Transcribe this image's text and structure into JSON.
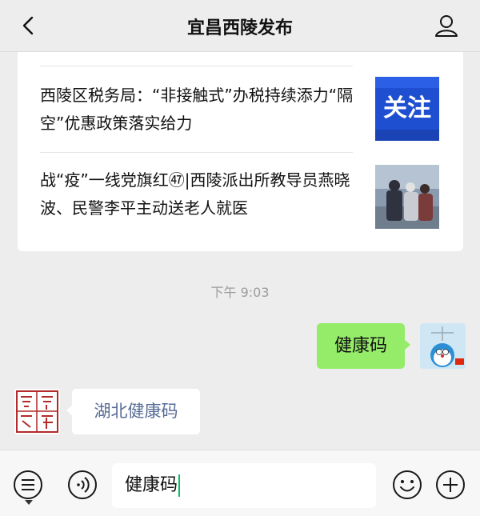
{
  "header": {
    "title": "宜昌西陵发布",
    "back_icon": "chevron-left-icon",
    "profile_icon": "person-icon"
  },
  "articles": [
    {
      "title": "西陵区税务局：“非接触式”办税持续添力“隔空”优惠政策落实给力",
      "thumb_label": "关注"
    },
    {
      "title": "战“疫”一线党旗红㊼|西陵派出所教导员燕晓波、民警李平主动送老人就医"
    }
  ],
  "chat": {
    "timestamp": "下午 9:03",
    "outgoing_message": "健康码",
    "incoming_message": "湖北健康码",
    "official_avatar_text": "西陵"
  },
  "input": {
    "value": "健康码",
    "left_icons": [
      "menu-list-icon",
      "voice-icon"
    ],
    "right_icons": [
      "emoji-icon",
      "plus-icon"
    ]
  },
  "colors": {
    "background": "#ededed",
    "outgoing_bubble": "#95ec69",
    "link_text": "#576b95",
    "caret": "#07c160",
    "thumb_blue": "#1f4fd1"
  }
}
